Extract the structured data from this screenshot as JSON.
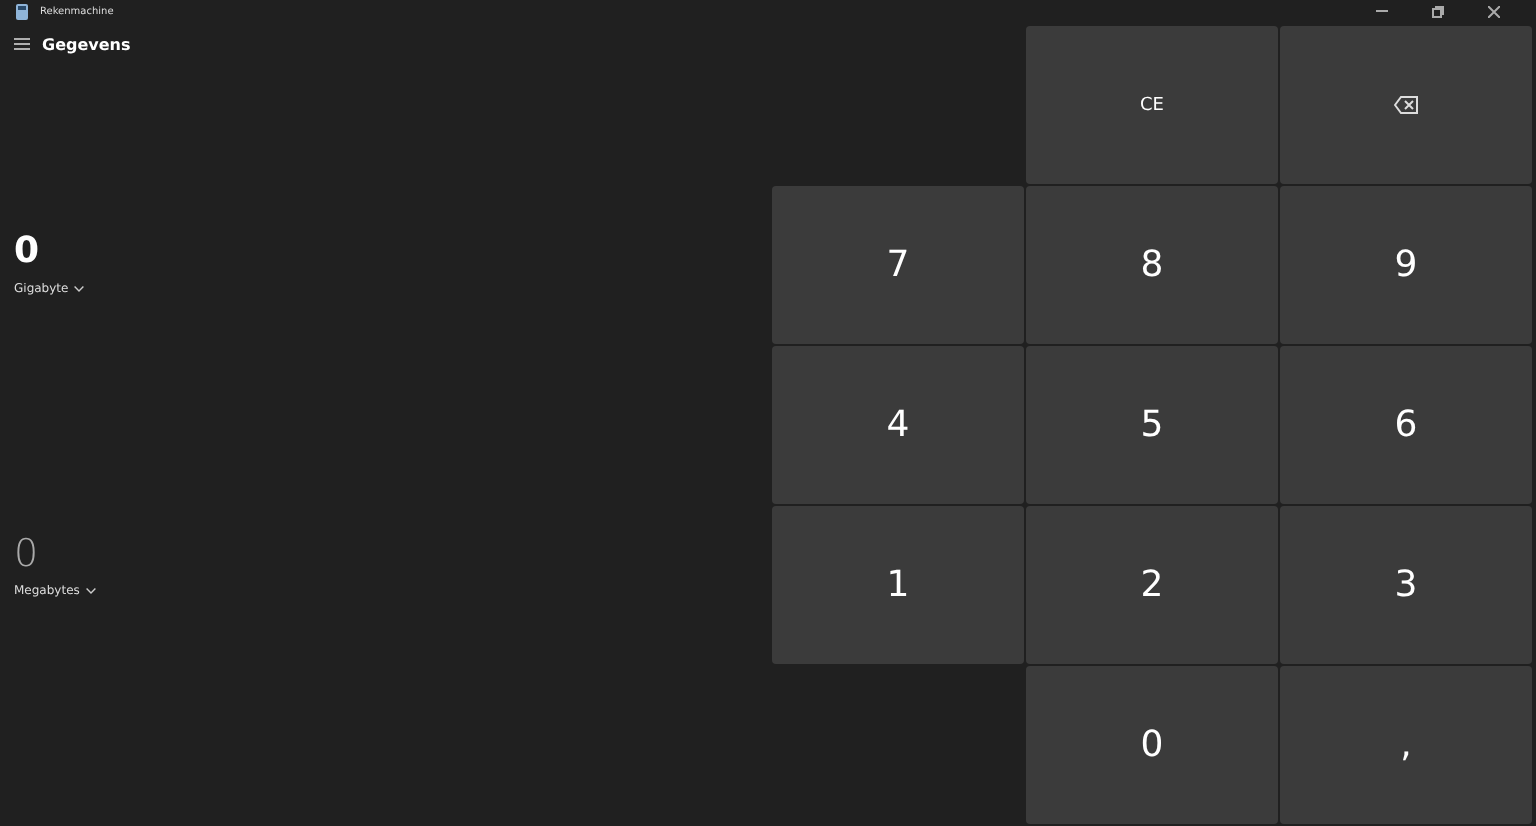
{
  "window": {
    "title": "Rekenmachine"
  },
  "header": {
    "title": "Gegevens"
  },
  "input": {
    "value": "0",
    "unit": "Gigabyte"
  },
  "output": {
    "value": "0",
    "unit": "Megabytes"
  },
  "keypad": [
    {
      "kind": "empty"
    },
    {
      "kind": "text",
      "label": "CE"
    },
    {
      "kind": "backspace"
    },
    {
      "kind": "digit",
      "label": "7"
    },
    {
      "kind": "digit",
      "label": "8"
    },
    {
      "kind": "digit",
      "label": "9"
    },
    {
      "kind": "digit",
      "label": "4"
    },
    {
      "kind": "digit",
      "label": "5"
    },
    {
      "kind": "digit",
      "label": "6"
    },
    {
      "kind": "digit",
      "label": "1"
    },
    {
      "kind": "digit",
      "label": "2"
    },
    {
      "kind": "digit",
      "label": "3"
    },
    {
      "kind": "empty"
    },
    {
      "kind": "digit",
      "label": "0"
    },
    {
      "kind": "digit",
      "label": ","
    }
  ]
}
